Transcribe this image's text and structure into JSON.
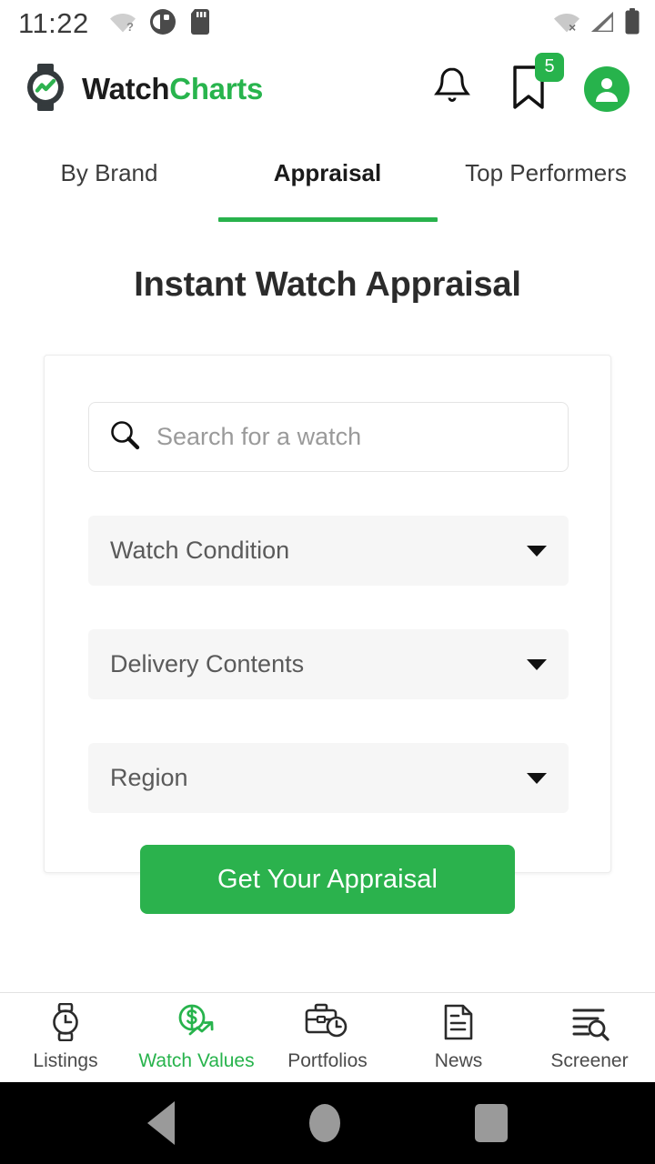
{
  "status_bar": {
    "time": "11:22",
    "left_icons": [
      "wifi-question-icon",
      "circle-half-icon",
      "sd-card-icon"
    ],
    "right_icons": [
      "wifi-off-icon",
      "cell-signal-icon",
      "battery-icon"
    ]
  },
  "header": {
    "brand_part1": "Watch",
    "brand_part2": "Charts",
    "logo_icon": "watchcharts-logo-icon",
    "notifications_icon": "bell-icon",
    "bookmarks_icon": "bookmark-icon",
    "bookmarks_badge": "5",
    "account_icon": "account-avatar-icon"
  },
  "tabs": [
    {
      "label": "By Brand",
      "active": false
    },
    {
      "label": "Appraisal",
      "active": true
    },
    {
      "label": "Top Performers",
      "active": false
    }
  ],
  "main": {
    "title": "Instant Watch Appraisal",
    "search": {
      "icon": "search-icon",
      "value": "",
      "placeholder": "Search for a watch"
    },
    "selects": [
      {
        "label": "Watch Condition",
        "icon": "chevron-down-icon"
      },
      {
        "label": "Delivery Contents",
        "icon": "chevron-down-icon"
      },
      {
        "label": "Region",
        "icon": "chevron-down-icon"
      }
    ],
    "cta_label": "Get Your Appraisal"
  },
  "bottom_nav": [
    {
      "label": "Listings",
      "icon": "watch-icon",
      "active": false
    },
    {
      "label": "Watch Values",
      "icon": "dollar-trend-icon",
      "active": true
    },
    {
      "label": "Portfolios",
      "icon": "briefcase-clock-icon",
      "active": false
    },
    {
      "label": "News",
      "icon": "news-document-icon",
      "active": false
    },
    {
      "label": "Screener",
      "icon": "list-search-icon",
      "active": false
    }
  ],
  "system_nav": {
    "back": "back-triangle-icon",
    "home": "home-circle-icon",
    "recents": "recents-square-icon"
  },
  "colors": {
    "accent_green": "#27b34c",
    "text_dark": "#2b2b2b",
    "field_bg": "#f6f6f6"
  }
}
